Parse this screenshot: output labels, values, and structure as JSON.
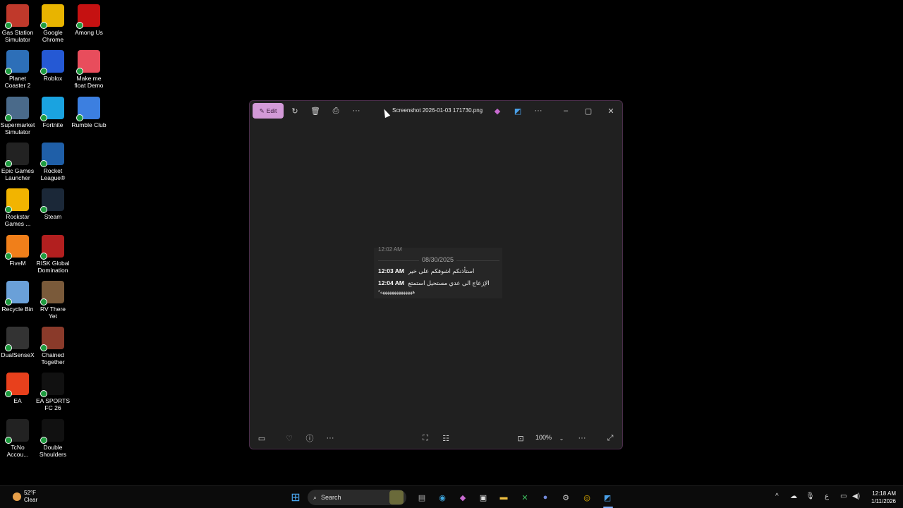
{
  "desktop": {
    "icons": [
      {
        "label": "Gas Station Simulator",
        "icon": "gas-station-icon",
        "color": "#c0392b"
      },
      {
        "label": "Google Chrome",
        "icon": "chrome-icon",
        "color": "#e8b400"
      },
      {
        "label": "Among Us",
        "icon": "among-us-icon",
        "color": "#c51111"
      },
      {
        "label": "Planet Coaster 2",
        "icon": "planet-coaster-icon",
        "color": "#2d6fb8"
      },
      {
        "label": "Roblox",
        "icon": "roblox-icon",
        "color": "#2559d4"
      },
      {
        "label": "Make me float Demo",
        "icon": "balloon-icon",
        "color": "#e84d5c"
      },
      {
        "label": "Supermarket Simulator",
        "icon": "supermarket-icon",
        "color": "#4a6a8a"
      },
      {
        "label": "Fortnite",
        "icon": "fortnite-icon",
        "color": "#1aa3e0"
      },
      {
        "label": "Rumble Club",
        "icon": "rumble-club-icon",
        "color": "#3c7fe0"
      },
      {
        "label": "Epic Games Launcher",
        "icon": "epic-games-icon",
        "color": "#222222"
      },
      {
        "label": "Rocket League®",
        "icon": "rocket-league-icon",
        "color": "#1f5fa8"
      },
      {
        "label": "Rockstar Games ...",
        "icon": "rockstar-icon",
        "color": "#f2b400"
      },
      {
        "label": "Steam",
        "icon": "steam-icon",
        "color": "#1b2838"
      },
      {
        "label": "FiveM",
        "icon": "fivem-icon",
        "color": "#f07f1a"
      },
      {
        "label": "RISK Global Domination",
        "icon": "risk-icon",
        "color": "#b21f1f"
      },
      {
        "label": "Recycle Bin",
        "icon": "recycle-bin-icon",
        "color": "#6aa0d8"
      },
      {
        "label": "RV There Yet",
        "icon": "rv-there-yet-icon",
        "color": "#7a5a3a"
      },
      {
        "label": "DualSenseX",
        "icon": "dualsensex-icon",
        "color": "#333333"
      },
      {
        "label": "Chained Together",
        "icon": "chained-together-icon",
        "color": "#8a3a2a"
      },
      {
        "label": "EA",
        "icon": "ea-icon",
        "color": "#e8401c"
      },
      {
        "label": "EA SPORTS FC 26",
        "icon": "ea-sports-fc-icon",
        "color": "#111111"
      },
      {
        "label": "TcNo Accou...",
        "icon": "tcno-icon",
        "color": "#222222"
      },
      {
        "label": "Double Shoulders",
        "icon": "double-shoulders-icon",
        "color": "#111111"
      }
    ]
  },
  "photos_window": {
    "edit_label": "Edit",
    "title": "Screenshot 2026-01-03 171730.png",
    "zoom": "100%",
    "image": {
      "top_fragment": "12:02 AM",
      "date": "08/30/2025",
      "messages": [
        {
          "time": "12:03 AM",
          "text": "استأذنكم اشوفكم على خير"
        },
        {
          "time": "12:04 AM",
          "text": "الإزعاج الى عدي مستحيل استمتع"
        }
      ],
      "trailing": "*ههههههههههههههه"
    }
  },
  "taskbar": {
    "weather_temp": "52°F",
    "weather_cond": "Clear",
    "search_label": "Search",
    "lang": "ع",
    "time": "12:18 AM",
    "date": "1/11/2026"
  }
}
